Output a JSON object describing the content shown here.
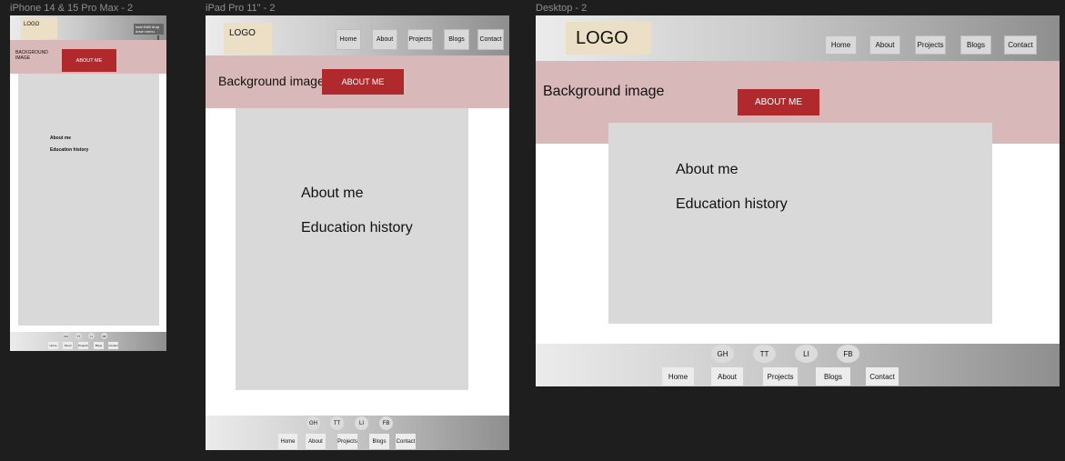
{
  "canvas": {
    "background": "#1e1e1e",
    "accent_button_color": "#b0292c",
    "hero_color": "#d9b8b9",
    "logo_color": "#ebe0c5",
    "box_color": "#d9d9d9"
  },
  "phone": {
    "label": "iPhone 14 & 15 Pro Max - 2",
    "logo": "LOGO",
    "note": "total DAB drop down menu",
    "arrow_icon": "arrow-down",
    "hero_text": "BACKGROUND IMAGE",
    "about_button": "ABOUT ME",
    "content": [
      "About me",
      "Education history"
    ],
    "social": [
      "GH",
      "TT",
      "LI",
      "FB"
    ],
    "footer_nav": [
      "Home",
      "About",
      "Projects",
      "Blogs",
      "Contact"
    ]
  },
  "tablet": {
    "label": "iPad Pro 11\" - 2",
    "logo": "LOGO",
    "nav": [
      "Home",
      "About",
      "Projects",
      "Blogs",
      "Contact"
    ],
    "hero_text": "Background image",
    "about_button": "ABOUT ME",
    "content": [
      "About me",
      "Education history"
    ],
    "social": [
      "GH",
      "TT",
      "LI",
      "FB"
    ],
    "footer_nav": [
      "Home",
      "About",
      "Projects",
      "Blogs",
      "Contact"
    ]
  },
  "desktop": {
    "label": "Desktop - 2",
    "logo": "LOGO",
    "nav": [
      "Home",
      "About",
      "Projects",
      "Blogs",
      "Contact"
    ],
    "hero_text": "Background image",
    "about_button": "ABOUT ME",
    "content": [
      "About me",
      "Education history"
    ],
    "social": [
      "GH",
      "TT",
      "LI",
      "FB"
    ],
    "footer_nav": [
      "Home",
      "About",
      "Projects",
      "Blogs",
      "Contact"
    ]
  }
}
